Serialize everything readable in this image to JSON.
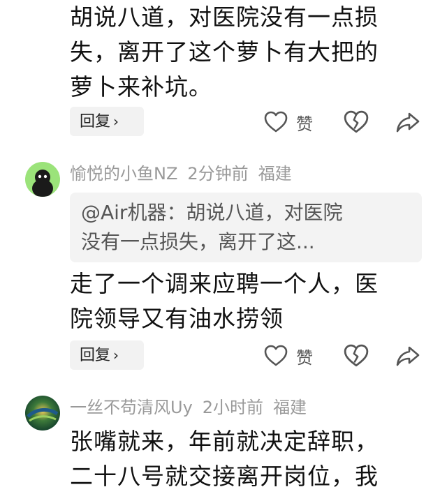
{
  "comments": [
    {
      "text_lines": [
        "胡说八道，对医院没有一点损",
        "失，离开了这个萝卜有大把的",
        "萝卜来补坑。"
      ]
    },
    {
      "username": "愉悦的小鱼NZ",
      "time": "2分钟前",
      "location": "福建",
      "quote_lines": [
        "@Air机器：胡说八道，对医院",
        "没有一点损失，离开了这..."
      ],
      "text_lines": [
        "走了一个调来应聘一个人，医",
        "院领导又有油水捞领"
      ]
    },
    {
      "username": "一丝不苟清风Uy",
      "time": "2小时前",
      "location": "福建",
      "text_lines": [
        "张嘴就来，年前就决定辞职，",
        "二十八号就交接离开岗位，我"
      ]
    }
  ],
  "actions": {
    "reply_label": "回复",
    "reply_chevron": "›",
    "like_label": "赞"
  },
  "icons": [
    "heart-outline-icon",
    "broken-heart-icon",
    "share-icon",
    "chevron-right-icon"
  ],
  "colors": {
    "text": "#111111",
    "meta": "#999999",
    "button_bg": "#f2f2f2",
    "quote_bg": "#f3f3f3",
    "icon": "#555555"
  }
}
